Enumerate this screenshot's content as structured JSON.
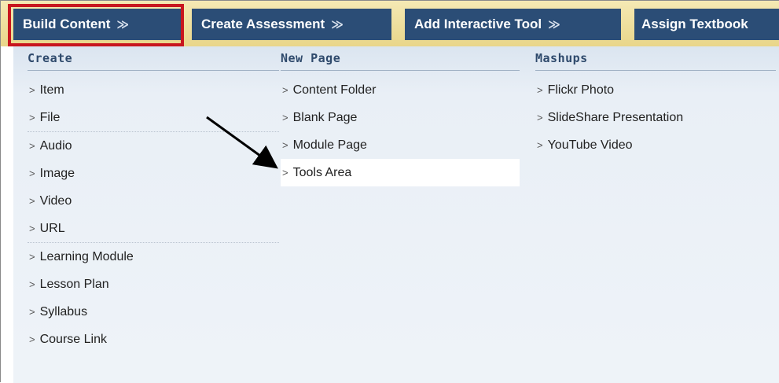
{
  "tabs": [
    {
      "label": "Build Content",
      "icon": "double-chevron-down-icon"
    },
    {
      "label": "Create Assessment",
      "icon": "double-chevron-down-icon"
    },
    {
      "label": "Add Interactive Tool",
      "icon": "double-chevron-down-icon"
    },
    {
      "label": "Assign Textbook",
      "icon": ""
    }
  ],
  "columns": {
    "create": {
      "heading": "Create",
      "items": [
        "Item",
        "File",
        "Audio",
        "Image",
        "Video",
        "URL",
        "Learning Module",
        "Lesson Plan",
        "Syllabus",
        "Course Link"
      ]
    },
    "new_page": {
      "heading": "New Page",
      "items": [
        "Content Folder",
        "Blank Page",
        "Module Page",
        "Tools Area"
      ]
    },
    "mashups": {
      "heading": "Mashups",
      "items": [
        "Flickr Photo",
        "SlideShare Presentation",
        "YouTube Video"
      ]
    }
  },
  "selected_item": "Tools Area",
  "colors": {
    "tab_bg": "#2b4d76",
    "highlight_border": "#c8161e",
    "panel_bg": "#e9eff6",
    "heading_text": "#2f4a6c"
  }
}
